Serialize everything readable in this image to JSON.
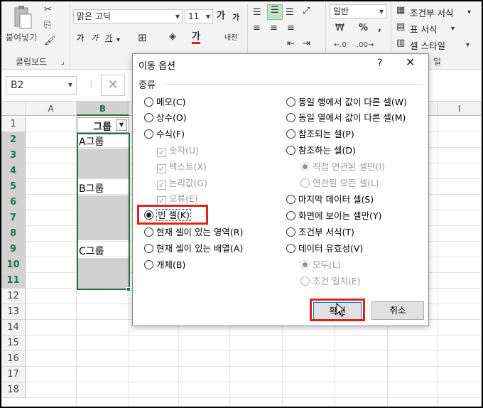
{
  "ribbon": {
    "clipboard": {
      "paste_label": "붙여넣기",
      "group_label": "클립보드"
    },
    "font": {
      "font_name": "맑은 고딕",
      "font_size": "11",
      "bold": "가",
      "italic": "가",
      "underline": "가",
      "grow": "가",
      "shrink": "가",
      "font_color": "가",
      "phonetic": "내천"
    },
    "number": {
      "format": "일반"
    },
    "styles": {
      "conditional": "조건부 서식",
      "table_format": "표 서식",
      "cell_styles": "셀 스타일",
      "group_tail": "일"
    }
  },
  "formula_bar": {
    "name_box": "B2"
  },
  "grid": {
    "columns": [
      "A",
      "B",
      "C",
      "D",
      "E",
      "F",
      "G",
      "H",
      "I"
    ],
    "rows": [
      "1",
      "2",
      "3",
      "4",
      "5",
      "6",
      "7",
      "8",
      "9",
      "10",
      "11",
      "12",
      "13",
      "14",
      "15",
      "16",
      "17",
      "18"
    ],
    "header_cell": "그룹",
    "groups": [
      "A그룹",
      "B그룹",
      "C그룹"
    ]
  },
  "dialog": {
    "title": "이동 옵션",
    "help": "?",
    "close": "✕",
    "type_label": "종류",
    "left_options": [
      {
        "label": "메모(C)"
      },
      {
        "label": "상수(O)"
      },
      {
        "label": "수식(F)"
      },
      {
        "label": "숫자(U)"
      },
      {
        "label": "텍스트(X)"
      },
      {
        "label": "논리값(G)"
      },
      {
        "label": "오류(E)"
      },
      {
        "label": "빈 셀(K)"
      },
      {
        "label": "현재 셀이 있는 영역(R)"
      },
      {
        "label": "현재 셀이 있는 배열(A)"
      },
      {
        "label": "개체(B)"
      }
    ],
    "right_options": [
      {
        "label": "동일 행에서 값이 다른 셀(W)"
      },
      {
        "label": "동일 열에서 값이 다른 셀(M)"
      },
      {
        "label": "참조되는 셀(P)"
      },
      {
        "label": "참조하는 셀(D)"
      },
      {
        "label": "직접 연관된 셀만(I)"
      },
      {
        "label": "연관된 모든 셀(L)"
      },
      {
        "label": "마지막 데이터 셀(S)"
      },
      {
        "label": "화면에 보이는 셀만(Y)"
      },
      {
        "label": "조건부 서식(T)"
      },
      {
        "label": "데이터 유효성(V)"
      },
      {
        "label": "모두(L)"
      },
      {
        "label": "조건 일치(E)"
      }
    ],
    "ok_label": "확인",
    "cancel_label": "취소"
  },
  "colors": {
    "accent_green": "#217346",
    "highlight_red": "#e0241b",
    "fill_gray": "#d0d0d0"
  }
}
